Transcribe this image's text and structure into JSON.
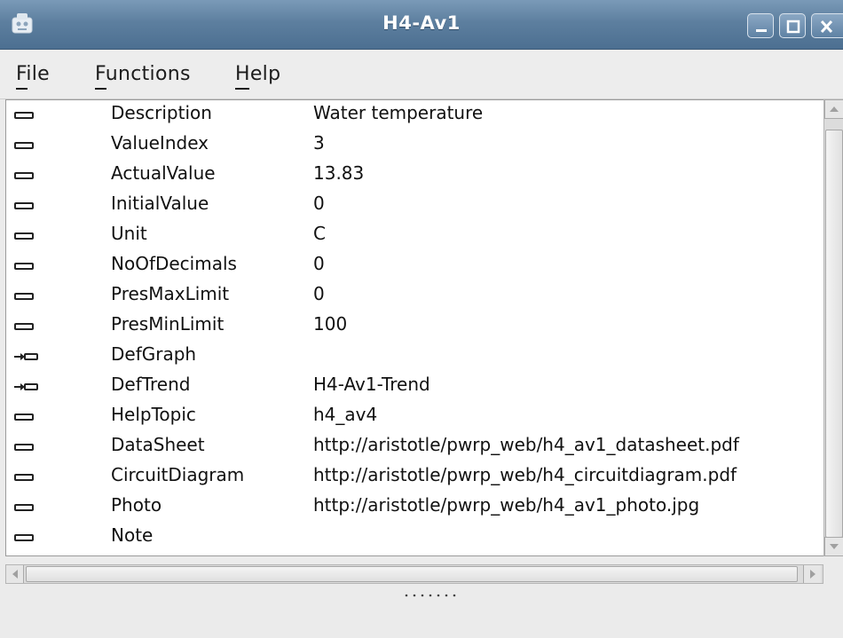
{
  "window": {
    "title": "H4-Av1",
    "app_icon": "robot-app-icon",
    "controls": [
      "minimize-icon",
      "maximize-icon",
      "close-icon"
    ],
    "titlebar_color": "#5d7f9f"
  },
  "menu": {
    "items": [
      {
        "label": "File",
        "mnemonic": "F"
      },
      {
        "label": "Functions",
        "mnemonic": "F"
      },
      {
        "label": "Help",
        "mnemonic": "H"
      }
    ]
  },
  "attributes": [
    {
      "name": "Description",
      "value": "Water temperature",
      "icon": "attribute-icon"
    },
    {
      "name": "ValueIndex",
      "value": "3",
      "icon": "attribute-icon"
    },
    {
      "name": "ActualValue",
      "value": "13.83",
      "icon": "attribute-icon"
    },
    {
      "name": "InitialValue",
      "value": "0",
      "icon": "attribute-icon"
    },
    {
      "name": "Unit",
      "value": "C",
      "icon": "attribute-icon"
    },
    {
      "name": "NoOfDecimals",
      "value": "0",
      "icon": "attribute-icon"
    },
    {
      "name": "PresMaxLimit",
      "value": "0",
      "icon": "attribute-icon"
    },
    {
      "name": "PresMinLimit",
      "value": "100",
      "icon": "attribute-icon"
    },
    {
      "name": "DefGraph",
      "value": "",
      "icon": "reference-arrow-icon"
    },
    {
      "name": "DefTrend",
      "value": "H4-Av1-Trend",
      "icon": "reference-arrow-icon"
    },
    {
      "name": "HelpTopic",
      "value": "h4_av4",
      "icon": "attribute-icon"
    },
    {
      "name": "DataSheet",
      "value": "http://aristotle/pwrp_web/h4_av1_datasheet.pdf",
      "icon": "attribute-icon"
    },
    {
      "name": "CircuitDiagram",
      "value": "http://aristotle/pwrp_web/h4_circuitdiagram.pdf",
      "icon": "attribute-icon"
    },
    {
      "name": "Photo",
      "value": "http://aristotle/pwrp_web/h4_av1_photo.jpg",
      "icon": "attribute-icon"
    },
    {
      "name": "Note",
      "value": "",
      "icon": "attribute-icon"
    }
  ]
}
